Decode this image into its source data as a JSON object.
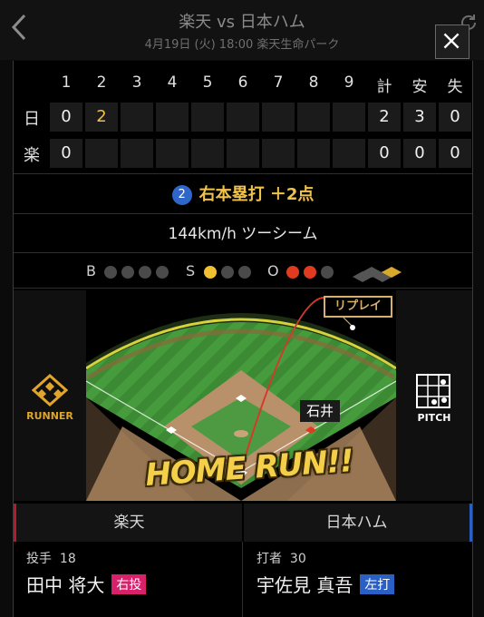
{
  "header": {
    "title": "楽天 vs 日本ハム",
    "subtitle": "4月19日 (火) 18:00 楽天生命パーク"
  },
  "scoreboard": {
    "innings": [
      "1",
      "2",
      "3",
      "4",
      "5",
      "6",
      "7",
      "8",
      "9"
    ],
    "totals_headers": [
      "計",
      "安",
      "失"
    ],
    "rows": [
      {
        "team": "日",
        "innings": [
          "0",
          "2",
          "",
          "",
          "",
          "",
          "",
          "",
          ""
        ],
        "totals": [
          "2",
          "3",
          "0"
        ]
      },
      {
        "team": "楽",
        "innings": [
          "0",
          "",
          "",
          "",
          "",
          "",
          "",
          "",
          ""
        ],
        "totals": [
          "0",
          "0",
          "0"
        ]
      }
    ]
  },
  "play": {
    "batter_number": "2",
    "result": "右本塁打 ＋2点",
    "pitch": "144km/h ツーシーム"
  },
  "count": {
    "balls_label": "B",
    "balls": 0,
    "balls_max": 4,
    "strikes_label": "S",
    "strikes": 1,
    "strikes_max": 3,
    "outs_label": "O",
    "outs": 2,
    "outs_max": 3
  },
  "field": {
    "replay_label": "リプレイ",
    "fielder_name": "石井",
    "banner": "HOME RUN!!",
    "runner_label": "RUNNER",
    "pitch_label": "PITCH"
  },
  "teams": {
    "left": "楽天",
    "right": "日本ハム"
  },
  "pitcher": {
    "role": "投手",
    "number": "18",
    "name": "田中 将大",
    "hand": "右投"
  },
  "batter": {
    "role": "打者",
    "number": "30",
    "name": "宇佐見 真吾",
    "hand": "左打"
  },
  "colors": {
    "accent": "#f0c24b",
    "strike": "#f0c030",
    "out": "#e03b20",
    "pitcher_hand": "#d8216b",
    "batter_hand": "#2a5fc4",
    "left_team_edge": "#b8182e",
    "right_team_edge": "#2a5fc4"
  },
  "icons": {
    "back": "chevron-left-icon",
    "close": "close-icon",
    "refresh": "refresh-icon",
    "runner": "base-diamond-icon",
    "pitch": "strike-zone-icon"
  }
}
